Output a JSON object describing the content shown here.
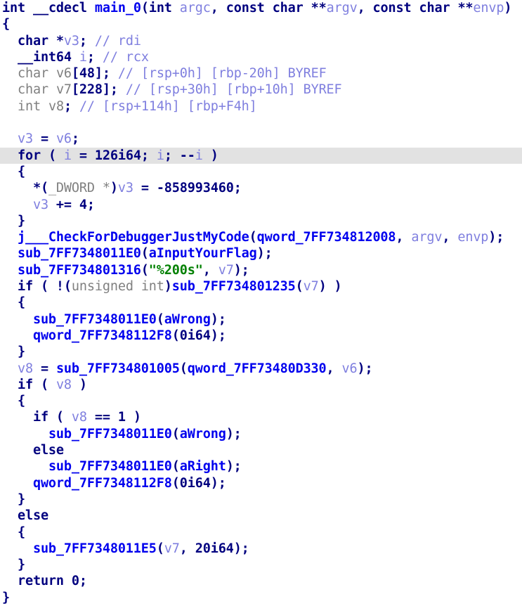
{
  "view": {
    "name": "ida-pseudocode-view",
    "background_color": "#ffffff",
    "highlight_color": "#e2e2e2",
    "font_size_px": 18.5,
    "line_height_px": 23.3
  },
  "colors": {
    "keyword": "#00007f",
    "type_grayed": "#808080",
    "function": "#0000ee",
    "symbol": "#0000ee",
    "variable": "#7f7fdf",
    "number": "#00007f",
    "string": "#008000",
    "comment": "#7f7fdf",
    "punctuation": "#00007f",
    "highlight_band": "#e2e2e2"
  },
  "function_signature": "int __cdecl main_0(int argc, const char **argv, const char **envp)",
  "code_lines": [
    {
      "index": 0,
      "highlighted": false,
      "text": "int __cdecl main_0(int argc, const char **argv, const char **envp)",
      "tokens": [
        {
          "t": "keyword",
          "v": "int"
        },
        {
          "t": "plain",
          "v": " "
        },
        {
          "t": "keyword",
          "v": "__cdecl"
        },
        {
          "t": "plain",
          "v": " "
        },
        {
          "t": "func",
          "v": "main_0"
        },
        {
          "t": "punct",
          "v": "("
        },
        {
          "t": "keyword",
          "v": "int"
        },
        {
          "t": "plain",
          "v": " "
        },
        {
          "t": "var",
          "v": "argc"
        },
        {
          "t": "punct",
          "v": ", "
        },
        {
          "t": "keyword",
          "v": "const"
        },
        {
          "t": "plain",
          "v": " "
        },
        {
          "t": "keyword",
          "v": "char"
        },
        {
          "t": "punct",
          "v": " **"
        },
        {
          "t": "var",
          "v": "argv"
        },
        {
          "t": "punct",
          "v": ", "
        },
        {
          "t": "keyword",
          "v": "const"
        },
        {
          "t": "plain",
          "v": " "
        },
        {
          "t": "keyword",
          "v": "char"
        },
        {
          "t": "punct",
          "v": " **"
        },
        {
          "t": "var",
          "v": "envp"
        },
        {
          "t": "punct",
          "v": ")"
        }
      ]
    },
    {
      "index": 1,
      "highlighted": false,
      "text": "{",
      "tokens": [
        {
          "t": "punct",
          "v": "{"
        }
      ]
    },
    {
      "index": 2,
      "highlighted": false,
      "text": "  char *v3; // rdi",
      "tokens": [
        {
          "t": "plain",
          "v": "  "
        },
        {
          "t": "keyword",
          "v": "char"
        },
        {
          "t": "punct",
          "v": " *"
        },
        {
          "t": "var",
          "v": "v3"
        },
        {
          "t": "punct",
          "v": ";"
        },
        {
          "t": "plain",
          "v": " "
        },
        {
          "t": "comment",
          "v": "// rdi"
        }
      ]
    },
    {
      "index": 3,
      "highlighted": false,
      "text": "  __int64 i; // rcx",
      "tokens": [
        {
          "t": "plain",
          "v": "  "
        },
        {
          "t": "keyword",
          "v": "__int64"
        },
        {
          "t": "plain",
          "v": " "
        },
        {
          "t": "var",
          "v": "i"
        },
        {
          "t": "punct",
          "v": ";"
        },
        {
          "t": "plain",
          "v": " "
        },
        {
          "t": "comment",
          "v": "// rcx"
        }
      ]
    },
    {
      "index": 4,
      "highlighted": false,
      "text": "  char v6[48]; // [rsp+0h] [rbp-20h] BYREF",
      "tokens": [
        {
          "t": "plain",
          "v": "  "
        },
        {
          "t": "type",
          "v": "char"
        },
        {
          "t": "plain",
          "v": " "
        },
        {
          "t": "type",
          "v": "v6"
        },
        {
          "t": "punct",
          "v": "["
        },
        {
          "t": "num",
          "v": "48"
        },
        {
          "t": "punct",
          "v": "];"
        },
        {
          "t": "plain",
          "v": " "
        },
        {
          "t": "comment",
          "v": "// [rsp+0h] [rbp-20h] BYREF"
        }
      ]
    },
    {
      "index": 5,
      "highlighted": false,
      "text": "  char v7[228]; // [rsp+30h] [rbp+10h] BYREF",
      "tokens": [
        {
          "t": "plain",
          "v": "  "
        },
        {
          "t": "type",
          "v": "char"
        },
        {
          "t": "plain",
          "v": " "
        },
        {
          "t": "type",
          "v": "v7"
        },
        {
          "t": "punct",
          "v": "["
        },
        {
          "t": "num",
          "v": "228"
        },
        {
          "t": "punct",
          "v": "];"
        },
        {
          "t": "plain",
          "v": " "
        },
        {
          "t": "comment",
          "v": "// [rsp+30h] [rbp+10h] BYREF"
        }
      ]
    },
    {
      "index": 6,
      "highlighted": false,
      "text": "  int v8; // [rsp+114h] [rbp+F4h]",
      "tokens": [
        {
          "t": "plain",
          "v": "  "
        },
        {
          "t": "type",
          "v": "int"
        },
        {
          "t": "plain",
          "v": " "
        },
        {
          "t": "type",
          "v": "v8"
        },
        {
          "t": "punct",
          "v": ";"
        },
        {
          "t": "plain",
          "v": " "
        },
        {
          "t": "comment",
          "v": "// [rsp+114h] [rbp+F4h]"
        }
      ]
    },
    {
      "index": 7,
      "highlighted": false,
      "text": "",
      "tokens": []
    },
    {
      "index": 8,
      "highlighted": false,
      "text": "  v3 = v6;",
      "tokens": [
        {
          "t": "plain",
          "v": "  "
        },
        {
          "t": "var",
          "v": "v3"
        },
        {
          "t": "punct",
          "v": " = "
        },
        {
          "t": "var",
          "v": "v6"
        },
        {
          "t": "punct",
          "v": ";"
        }
      ]
    },
    {
      "index": 9,
      "highlighted": true,
      "text": "  for ( i = 126i64; i; --i )",
      "tokens": [
        {
          "t": "plain",
          "v": "  "
        },
        {
          "t": "keyword",
          "v": "for"
        },
        {
          "t": "punct",
          "v": " ( "
        },
        {
          "t": "var",
          "v": "i"
        },
        {
          "t": "punct",
          "v": " = "
        },
        {
          "t": "num",
          "v": "126i64"
        },
        {
          "t": "punct",
          "v": "; "
        },
        {
          "t": "var",
          "v": "i"
        },
        {
          "t": "punct",
          "v": "; --"
        },
        {
          "t": "var",
          "v": "i"
        },
        {
          "t": "punct",
          "v": " )"
        }
      ]
    },
    {
      "index": 10,
      "highlighted": false,
      "text": "  {",
      "tokens": [
        {
          "t": "plain",
          "v": "  "
        },
        {
          "t": "punct",
          "v": "{"
        }
      ]
    },
    {
      "index": 11,
      "highlighted": false,
      "text": "    *(_DWORD *)v3 = -858993460;",
      "tokens": [
        {
          "t": "plain",
          "v": "    "
        },
        {
          "t": "punct",
          "v": "*("
        },
        {
          "t": "type",
          "v": "_DWORD"
        },
        {
          "t": "type",
          "v": " *"
        },
        {
          "t": "punct",
          "v": ")"
        },
        {
          "t": "var",
          "v": "v3"
        },
        {
          "t": "punct",
          "v": " = "
        },
        {
          "t": "num",
          "v": "-858993460"
        },
        {
          "t": "punct",
          "v": ";"
        }
      ]
    },
    {
      "index": 12,
      "highlighted": false,
      "text": "    v3 += 4;",
      "tokens": [
        {
          "t": "plain",
          "v": "    "
        },
        {
          "t": "var",
          "v": "v3"
        },
        {
          "t": "punct",
          "v": " += "
        },
        {
          "t": "num",
          "v": "4"
        },
        {
          "t": "punct",
          "v": ";"
        }
      ]
    },
    {
      "index": 13,
      "highlighted": false,
      "text": "  }",
      "tokens": [
        {
          "t": "plain",
          "v": "  "
        },
        {
          "t": "punct",
          "v": "}"
        }
      ]
    },
    {
      "index": 14,
      "highlighted": false,
      "text": "  j___CheckForDebuggerJustMyCode(qword_7FF734812008, argv, envp);",
      "tokens": [
        {
          "t": "plain",
          "v": "  "
        },
        {
          "t": "func",
          "v": "j___CheckForDebuggerJustMyCode"
        },
        {
          "t": "punct",
          "v": "("
        },
        {
          "t": "func",
          "v": "qword_7FF734812008"
        },
        {
          "t": "punct",
          "v": ", "
        },
        {
          "t": "var",
          "v": "argv"
        },
        {
          "t": "punct",
          "v": ", "
        },
        {
          "t": "var",
          "v": "envp"
        },
        {
          "t": "punct",
          "v": ");"
        }
      ]
    },
    {
      "index": 15,
      "highlighted": false,
      "text": "  sub_7FF7348011E0(aInputYourFlag);",
      "tokens": [
        {
          "t": "plain",
          "v": "  "
        },
        {
          "t": "func",
          "v": "sub_7FF7348011E0"
        },
        {
          "t": "punct",
          "v": "("
        },
        {
          "t": "symbol",
          "v": "aInputYourFlag"
        },
        {
          "t": "punct",
          "v": ");"
        }
      ]
    },
    {
      "index": 16,
      "highlighted": false,
      "text": "  sub_7FF734801316(\"%200s\", v7);",
      "tokens": [
        {
          "t": "plain",
          "v": "  "
        },
        {
          "t": "func",
          "v": "sub_7FF734801316"
        },
        {
          "t": "punct",
          "v": "("
        },
        {
          "t": "string",
          "v": "\"%200s\""
        },
        {
          "t": "punct",
          "v": ", "
        },
        {
          "t": "var",
          "v": "v7"
        },
        {
          "t": "punct",
          "v": ");"
        }
      ]
    },
    {
      "index": 17,
      "highlighted": false,
      "text": "  if ( !(unsigned int)sub_7FF734801235(v7) )",
      "tokens": [
        {
          "t": "plain",
          "v": "  "
        },
        {
          "t": "keyword",
          "v": "if"
        },
        {
          "t": "punct",
          "v": " ( !("
        },
        {
          "t": "type",
          "v": "unsigned int"
        },
        {
          "t": "punct",
          "v": ")"
        },
        {
          "t": "func",
          "v": "sub_7FF734801235"
        },
        {
          "t": "punct",
          "v": "("
        },
        {
          "t": "var",
          "v": "v7"
        },
        {
          "t": "punct",
          "v": ") )"
        }
      ]
    },
    {
      "index": 18,
      "highlighted": false,
      "text": "  {",
      "tokens": [
        {
          "t": "plain",
          "v": "  "
        },
        {
          "t": "punct",
          "v": "{"
        }
      ]
    },
    {
      "index": 19,
      "highlighted": false,
      "text": "    sub_7FF7348011E0(aWrong);",
      "tokens": [
        {
          "t": "plain",
          "v": "    "
        },
        {
          "t": "func",
          "v": "sub_7FF7348011E0"
        },
        {
          "t": "punct",
          "v": "("
        },
        {
          "t": "symbol",
          "v": "aWrong"
        },
        {
          "t": "punct",
          "v": ");"
        }
      ]
    },
    {
      "index": 20,
      "highlighted": false,
      "text": "    qword_7FF7348112F8(0i64);",
      "tokens": [
        {
          "t": "plain",
          "v": "    "
        },
        {
          "t": "func",
          "v": "qword_7FF7348112F8"
        },
        {
          "t": "punct",
          "v": "("
        },
        {
          "t": "num",
          "v": "0i64"
        },
        {
          "t": "punct",
          "v": ");"
        }
      ]
    },
    {
      "index": 21,
      "highlighted": false,
      "text": "  }",
      "tokens": [
        {
          "t": "plain",
          "v": "  "
        },
        {
          "t": "punct",
          "v": "}"
        }
      ]
    },
    {
      "index": 22,
      "highlighted": false,
      "text": "  v8 = sub_7FF734801005(qword_7FF73480D330, v6);",
      "tokens": [
        {
          "t": "plain",
          "v": "  "
        },
        {
          "t": "var",
          "v": "v8"
        },
        {
          "t": "punct",
          "v": " = "
        },
        {
          "t": "func",
          "v": "sub_7FF734801005"
        },
        {
          "t": "punct",
          "v": "("
        },
        {
          "t": "func",
          "v": "qword_7FF73480D330"
        },
        {
          "t": "punct",
          "v": ", "
        },
        {
          "t": "var",
          "v": "v6"
        },
        {
          "t": "punct",
          "v": ");"
        }
      ]
    },
    {
      "index": 23,
      "highlighted": false,
      "text": "  if ( v8 )",
      "tokens": [
        {
          "t": "plain",
          "v": "  "
        },
        {
          "t": "keyword",
          "v": "if"
        },
        {
          "t": "punct",
          "v": " ( "
        },
        {
          "t": "var",
          "v": "v8"
        },
        {
          "t": "punct",
          "v": " )"
        }
      ]
    },
    {
      "index": 24,
      "highlighted": false,
      "text": "  {",
      "tokens": [
        {
          "t": "plain",
          "v": "  "
        },
        {
          "t": "punct",
          "v": "{"
        }
      ]
    },
    {
      "index": 25,
      "highlighted": false,
      "text": "    if ( v8 == 1 )",
      "tokens": [
        {
          "t": "plain",
          "v": "    "
        },
        {
          "t": "keyword",
          "v": "if"
        },
        {
          "t": "punct",
          "v": " ( "
        },
        {
          "t": "var",
          "v": "v8"
        },
        {
          "t": "punct",
          "v": " == "
        },
        {
          "t": "num",
          "v": "1"
        },
        {
          "t": "punct",
          "v": " )"
        }
      ]
    },
    {
      "index": 26,
      "highlighted": false,
      "text": "      sub_7FF7348011E0(aWrong);",
      "tokens": [
        {
          "t": "plain",
          "v": "      "
        },
        {
          "t": "func",
          "v": "sub_7FF7348011E0"
        },
        {
          "t": "punct",
          "v": "("
        },
        {
          "t": "symbol",
          "v": "aWrong"
        },
        {
          "t": "punct",
          "v": ");"
        }
      ]
    },
    {
      "index": 27,
      "highlighted": false,
      "text": "    else",
      "tokens": [
        {
          "t": "plain",
          "v": "    "
        },
        {
          "t": "keyword",
          "v": "else"
        }
      ]
    },
    {
      "index": 28,
      "highlighted": false,
      "text": "      sub_7FF7348011E0(aRight);",
      "tokens": [
        {
          "t": "plain",
          "v": "      "
        },
        {
          "t": "func",
          "v": "sub_7FF7348011E0"
        },
        {
          "t": "punct",
          "v": "("
        },
        {
          "t": "symbol",
          "v": "aRight"
        },
        {
          "t": "punct",
          "v": ");"
        }
      ]
    },
    {
      "index": 29,
      "highlighted": false,
      "text": "    qword_7FF7348112F8(0i64);",
      "tokens": [
        {
          "t": "plain",
          "v": "    "
        },
        {
          "t": "func",
          "v": "qword_7FF7348112F8"
        },
        {
          "t": "punct",
          "v": "("
        },
        {
          "t": "num",
          "v": "0i64"
        },
        {
          "t": "punct",
          "v": ");"
        }
      ]
    },
    {
      "index": 30,
      "highlighted": false,
      "text": "  }",
      "tokens": [
        {
          "t": "plain",
          "v": "  "
        },
        {
          "t": "punct",
          "v": "}"
        }
      ]
    },
    {
      "index": 31,
      "highlighted": false,
      "text": "  else",
      "tokens": [
        {
          "t": "plain",
          "v": "  "
        },
        {
          "t": "keyword",
          "v": "else"
        }
      ]
    },
    {
      "index": 32,
      "highlighted": false,
      "text": "  {",
      "tokens": [
        {
          "t": "plain",
          "v": "  "
        },
        {
          "t": "punct",
          "v": "{"
        }
      ]
    },
    {
      "index": 33,
      "highlighted": false,
      "text": "    sub_7FF7348011E5(v7, 20i64);",
      "tokens": [
        {
          "t": "plain",
          "v": "    "
        },
        {
          "t": "func",
          "v": "sub_7FF7348011E5"
        },
        {
          "t": "punct",
          "v": "("
        },
        {
          "t": "var",
          "v": "v7"
        },
        {
          "t": "punct",
          "v": ", "
        },
        {
          "t": "num",
          "v": "20i64"
        },
        {
          "t": "punct",
          "v": ");"
        }
      ]
    },
    {
      "index": 34,
      "highlighted": false,
      "text": "  }",
      "tokens": [
        {
          "t": "plain",
          "v": "  "
        },
        {
          "t": "punct",
          "v": "}"
        }
      ]
    },
    {
      "index": 35,
      "highlighted": false,
      "text": "  return 0;",
      "tokens": [
        {
          "t": "plain",
          "v": "  "
        },
        {
          "t": "keyword",
          "v": "return"
        },
        {
          "t": "plain",
          "v": " "
        },
        {
          "t": "num",
          "v": "0"
        },
        {
          "t": "punct",
          "v": ";"
        }
      ]
    },
    {
      "index": 36,
      "highlighted": false,
      "text": "}",
      "tokens": [
        {
          "t": "punct",
          "v": "}"
        }
      ]
    }
  ]
}
